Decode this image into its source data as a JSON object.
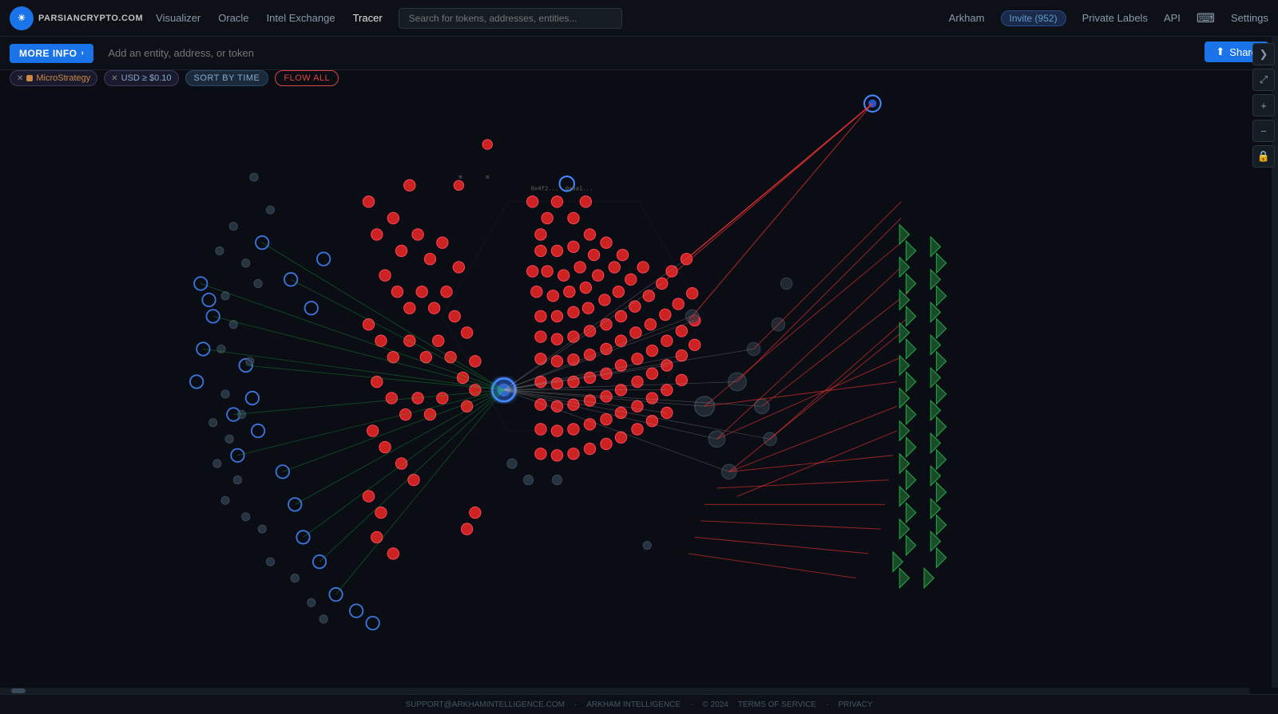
{
  "logo": {
    "symbol": "☀",
    "text": "PARSIANCRYPTO.COM"
  },
  "nav": {
    "links": [
      {
        "label": "Visualizer",
        "active": false
      },
      {
        "label": "Oracle",
        "active": false
      },
      {
        "label": "Intel Exchange",
        "active": false
      },
      {
        "label": "Tracer",
        "active": true
      }
    ],
    "search_placeholder": "Search for tokens, addresses, entities...",
    "right_items": [
      {
        "label": "Arkham"
      },
      {
        "label": "Invite (952)",
        "type": "badge"
      },
      {
        "label": "Private Labels"
      },
      {
        "label": "API"
      },
      {
        "label": "⌨",
        "type": "icon"
      },
      {
        "label": "Settings"
      }
    ]
  },
  "toolbar": {
    "more_info_label": "MoRE INFO",
    "more_info_arrow": "›",
    "entity_placeholder": "Add an entity, address, or token"
  },
  "filters": {
    "microstrategy_label": "MicroStrategy",
    "usd_label": "USD ≥ $0.10",
    "sort_label": "SORT BY TIME",
    "flow_label": "FLOW ALL"
  },
  "share": {
    "label": "Share",
    "icon": "⬆"
  },
  "tools": [
    {
      "icon": "❯",
      "name": "expand-right"
    },
    {
      "icon": "⤢",
      "name": "expand-all"
    },
    {
      "icon": "+",
      "name": "zoom-in"
    },
    {
      "icon": "−",
      "name": "zoom-out"
    },
    {
      "icon": "🔒",
      "name": "lock"
    }
  ],
  "footer": {
    "email": "SUPPORT@ARKHAMINTELLIGENCE.COM",
    "company": "ARKHAM INTELLIGENCE",
    "year": "© 2024",
    "terms": "TERMS OF SERVICE",
    "privacy": "PRIVACY",
    "separator": "·"
  },
  "graph": {
    "description": "Transaction flow graph showing MicroStrategy blockchain transactions",
    "node_colors": {
      "blue_circle": "#4488ff",
      "red_node": "#cc3333",
      "gray_node": "#445566",
      "green_arrow": "#22aa44",
      "center_blue": "#2255cc"
    }
  }
}
